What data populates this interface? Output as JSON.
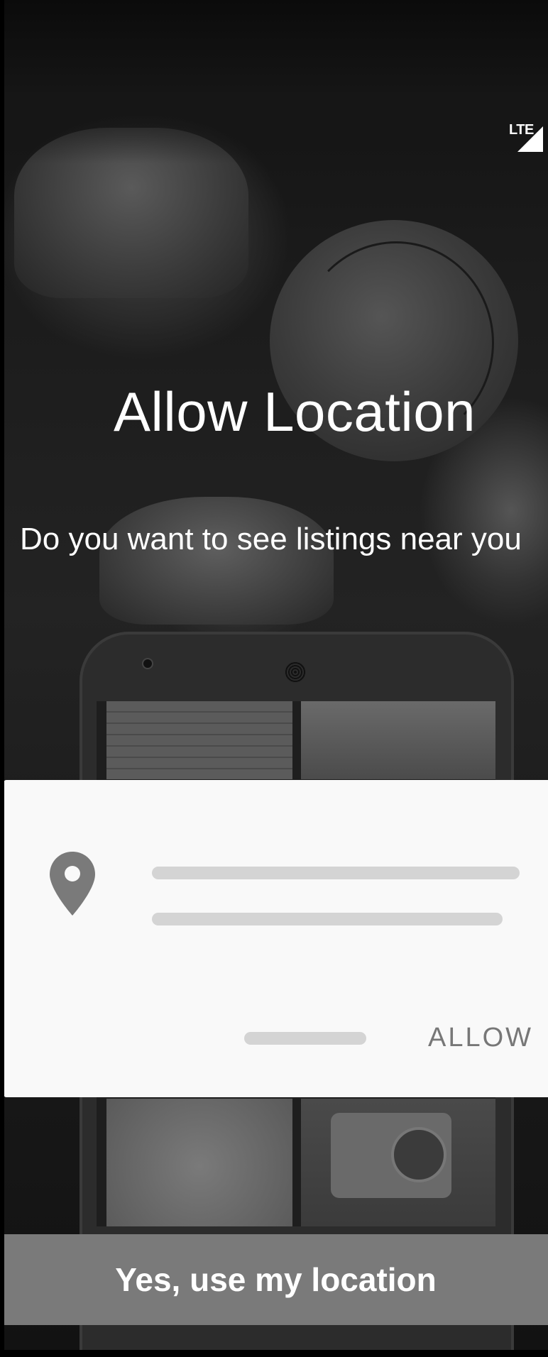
{
  "status_bar": {
    "network_label": "LTE",
    "signal_icon": "cellular-signal-icon"
  },
  "intro": {
    "title": "Allow Location",
    "subtitle": "Do you want to see listings near you"
  },
  "dialog_illustration": {
    "icon": "location-pin-icon",
    "primary_action_label": "ALLOW",
    "colors": {
      "card": "#f9f9f9",
      "placeholder_bar": "#d4d4d4",
      "icon": "#7a7a7a",
      "action_text": "#777777"
    }
  },
  "cta": {
    "label": "Yes, use my location",
    "color": "#7a7a7a"
  }
}
